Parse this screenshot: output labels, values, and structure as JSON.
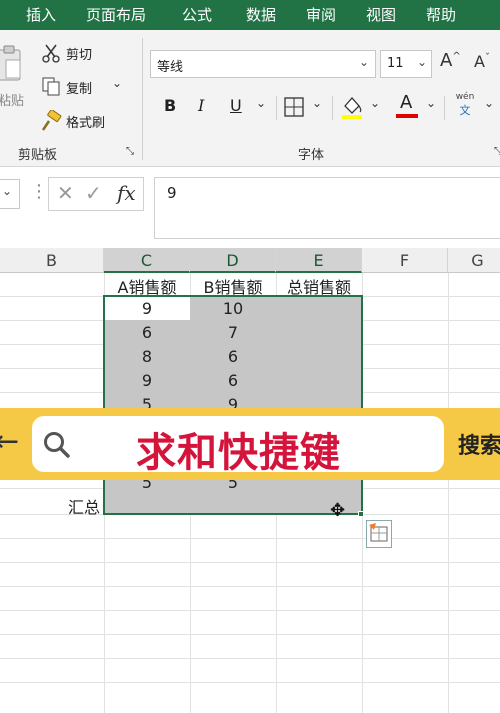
{
  "menu": [
    "插入",
    "页面布局",
    "公式",
    "数据",
    "审阅",
    "视图",
    "帮助"
  ],
  "clipboard": {
    "paste_partial": "粘贴",
    "cut": "剪切",
    "copy": "复制",
    "format_painter": "格式刷",
    "group": "剪贴板"
  },
  "font": {
    "name": "等线",
    "size": "11",
    "bold": "B",
    "italic": "I",
    "underline": "U",
    "font_color_glyph": "A",
    "phonetic_top": "wén",
    "phonetic_bottom": "文",
    "group": "字体"
  },
  "formula_bar": {
    "fx": "fx",
    "value": "9"
  },
  "columns": [
    "B",
    "C",
    "D",
    "E",
    "F",
    "G"
  ],
  "headers": {
    "C": "A销售额",
    "D": "B销售额",
    "E": "总销售额"
  },
  "rows": [
    {
      "C": "9",
      "D": "10"
    },
    {
      "C": "6",
      "D": "7"
    },
    {
      "C": "8",
      "D": "6"
    },
    {
      "C": "9",
      "D": "6"
    },
    {
      "C": "5",
      "D": "9"
    },
    {
      "C": "5",
      "D": "5"
    }
  ],
  "total_label": "汇总",
  "banner": {
    "text": "求和快捷键",
    "search": "搜索"
  },
  "colors": {
    "excel_green": "#217346",
    "banner_yellow": "#f5c945",
    "banner_text": "#d4143a",
    "selection": "#c6c6c6"
  }
}
